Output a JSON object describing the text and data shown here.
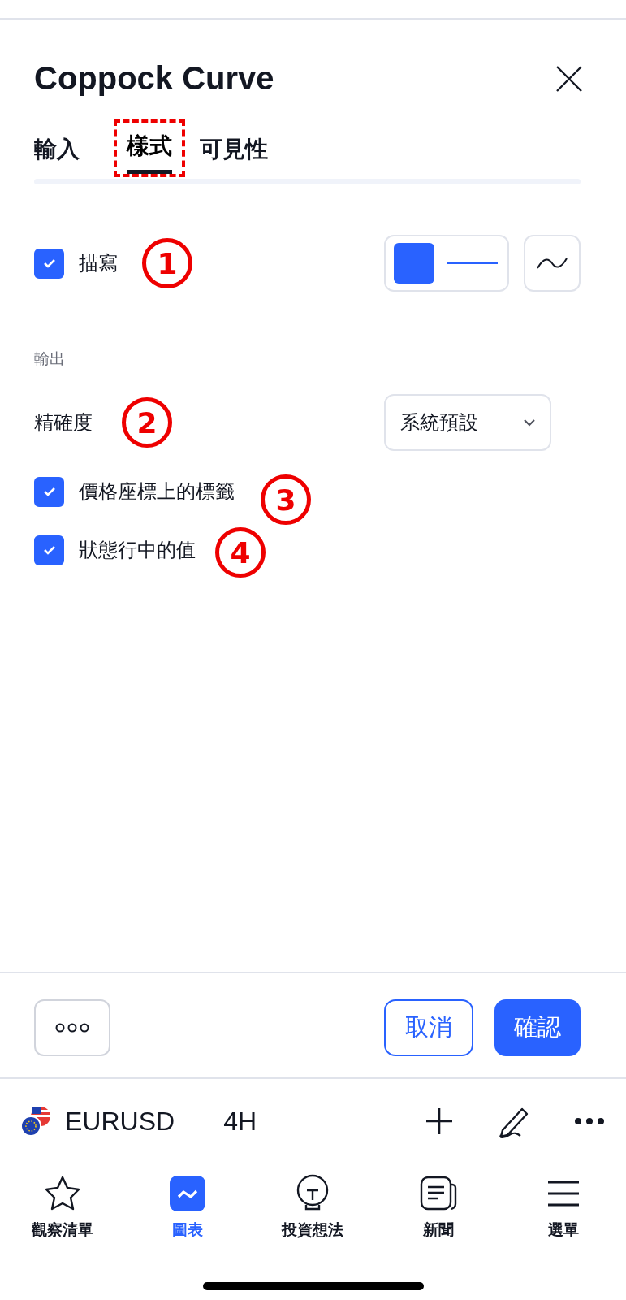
{
  "dialog": {
    "title": "Coppock Curve"
  },
  "tabs": [
    {
      "label": "輸入",
      "selected": false
    },
    {
      "label": "樣式",
      "selected": true,
      "highlighted": true
    },
    {
      "label": "可見性",
      "selected": false
    }
  ],
  "plot": {
    "label": "描寫",
    "checked": true,
    "color": "#2962ff",
    "annotation": "1"
  },
  "output_section": {
    "heading": "輸出"
  },
  "precision": {
    "label": "精確度",
    "value": "系統預設",
    "annotation": "2"
  },
  "options": [
    {
      "label": "價格座標上的標籤",
      "checked": true,
      "annotation": "3"
    },
    {
      "label": "狀態行中的值",
      "checked": true,
      "annotation": "4"
    }
  ],
  "footer": {
    "cancel": "取消",
    "confirm": "確認"
  },
  "symbol_bar": {
    "symbol": "EURUSD",
    "interval": "4H"
  },
  "nav": [
    {
      "label": "觀察清單",
      "kind": "star",
      "selected": false
    },
    {
      "label": "圖表",
      "kind": "chart",
      "selected": true
    },
    {
      "label": "投資想法",
      "kind": "bulb",
      "selected": false
    },
    {
      "label": "新聞",
      "kind": "news",
      "selected": false
    },
    {
      "label": "選單",
      "kind": "menu",
      "selected": false
    }
  ]
}
